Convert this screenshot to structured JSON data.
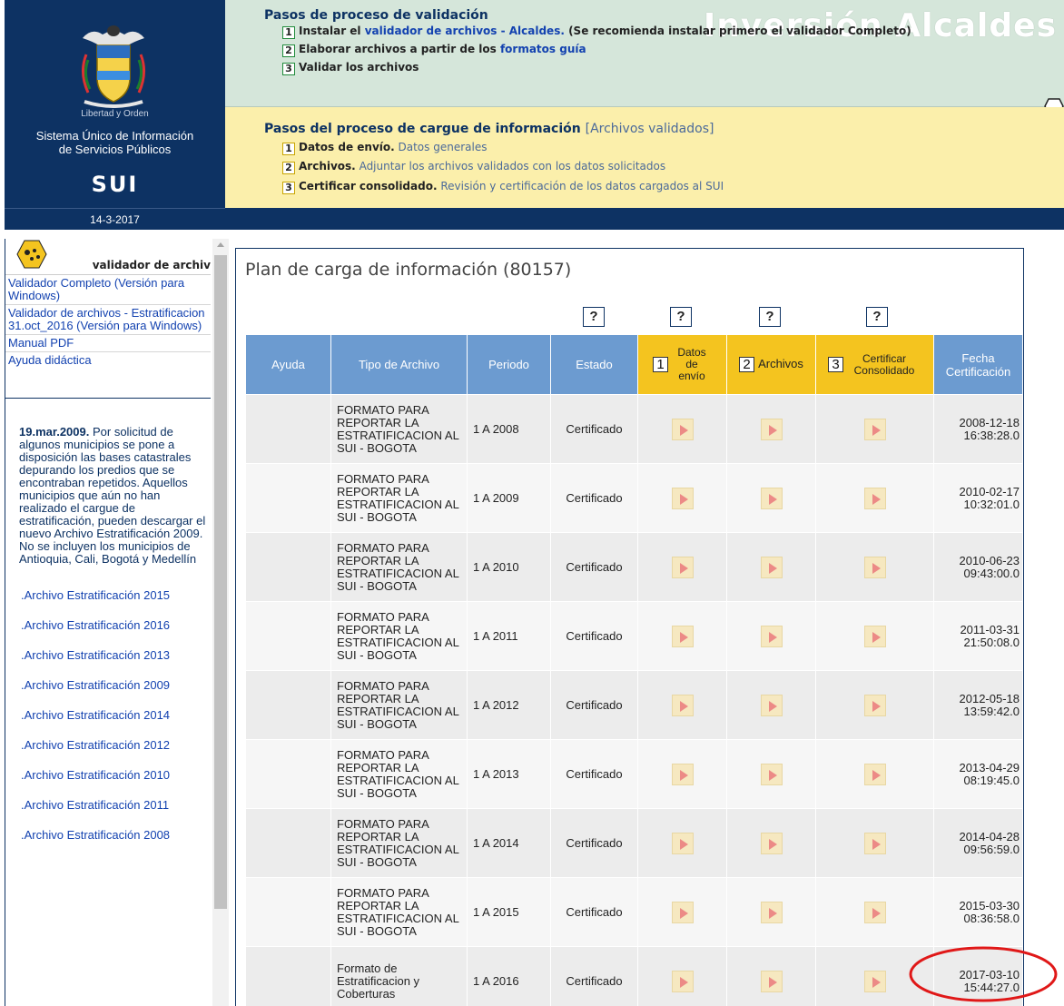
{
  "header": {
    "motto": "Libertad y Orden",
    "system_name_line1": "Sistema Único de Información",
    "system_name_line2": "de Servicios Públicos",
    "acronym": "SUI",
    "date": "14-3-2017",
    "brand": "Inversión Alcaldes",
    "validation": {
      "title": "Pasos de proceso de validación",
      "steps": [
        {
          "num": "1",
          "text": "Instalar el ",
          "link": "validador de archivos - Alcaldes.",
          "note": " (Se recomienda instalar primero el validador Completo)"
        },
        {
          "num": "2",
          "text": "Elaborar archivos a partir de los ",
          "link": "formatos guía",
          "note": ""
        },
        {
          "num": "3",
          "text": "Validar los archivos",
          "link": "",
          "note": ""
        }
      ]
    },
    "cargue": {
      "title": "Pasos del proceso de cargue de información",
      "title_note": "[Archivos validados]",
      "steps": [
        {
          "num": "1",
          "label": "Datos de envío.",
          "desc": " Datos generales"
        },
        {
          "num": "2",
          "label": "Archivos.",
          "desc": " Adjuntar los archivos validados con los datos solicitados"
        },
        {
          "num": "3",
          "label": "Certificar consolidado.",
          "desc": " Revisión y certificación de los datos cargados al SUI"
        }
      ]
    }
  },
  "sidebar": {
    "validator_label": "validador de archiv",
    "links": [
      "Validador Completo (Versión para Windows)",
      "Validador de archivos - Estratificacion 31.oct_2016 (Versión para Windows)",
      "Manual PDF",
      "Ayuda didáctica"
    ],
    "news_date": "19.mar.2009.",
    "news_text": " Por solicitud de algunos municipios se pone a disposición las bases catastrales depurando los predios que se encontraban repetidos. Aquellos municipios que aún no han realizado el cargue de estratificación, pueden descargar el nuevo Archivo Estratificación 2009. No se incluyen los municipios de Antioquia, Cali, Bogotá y Medellín",
    "archives": [
      ".Archivo Estratificación 2015",
      ".Archivo Estratificación 2016",
      ".Archivo Estratificación 2013",
      ".Archivo Estratificación 2009",
      ".Archivo Estratificación 2014",
      ".Archivo Estratificación 2012",
      ".Archivo Estratificación 2010",
      ".Archivo Estratificación 2011",
      ".Archivo Estratificación 2008"
    ]
  },
  "main": {
    "title": "Plan de carga de información (80157)",
    "help_label": "?",
    "columns": {
      "ayuda": "Ayuda",
      "tipo": "Tipo de Archivo",
      "periodo": "Periodo",
      "estado": "Estado",
      "datos_num": "1",
      "datos": "Datos de envío",
      "archivos_num": "2",
      "archivos": "Archivos",
      "certificar_num": "3",
      "certificar": "Certificar Consolidado",
      "fecha": "Fecha Certificación"
    },
    "rows": [
      {
        "tipo": "FORMATO PARA REPORTAR LA ESTRATIFICACION AL SUI - BOGOTA",
        "periodo": "1 A 2008",
        "estado": "Certificado",
        "fecha": "2008-12-18 16:38:28.0"
      },
      {
        "tipo": "FORMATO PARA REPORTAR LA ESTRATIFICACION AL SUI - BOGOTA",
        "periodo": "1 A 2009",
        "estado": "Certificado",
        "fecha": "2010-02-17 10:32:01.0"
      },
      {
        "tipo": "FORMATO PARA REPORTAR LA ESTRATIFICACION AL SUI - BOGOTA",
        "periodo": "1 A 2010",
        "estado": "Certificado",
        "fecha": "2010-06-23 09:43:00.0"
      },
      {
        "tipo": "FORMATO PARA REPORTAR LA ESTRATIFICACION AL SUI - BOGOTA",
        "periodo": "1 A 2011",
        "estado": "Certificado",
        "fecha": "2011-03-31 21:50:08.0"
      },
      {
        "tipo": "FORMATO PARA REPORTAR LA ESTRATIFICACION AL SUI - BOGOTA",
        "periodo": "1 A 2012",
        "estado": "Certificado",
        "fecha": "2012-05-18 13:59:42.0"
      },
      {
        "tipo": "FORMATO PARA REPORTAR LA ESTRATIFICACION AL SUI - BOGOTA",
        "periodo": "1 A 2013",
        "estado": "Certificado",
        "fecha": "2013-04-29 08:19:45.0"
      },
      {
        "tipo": "FORMATO PARA REPORTAR LA ESTRATIFICACION AL SUI - BOGOTA",
        "periodo": "1 A 2014",
        "estado": "Certificado",
        "fecha": "2014-04-28 09:56:59.0"
      },
      {
        "tipo": "FORMATO PARA REPORTAR LA ESTRATIFICACION AL SUI - BOGOTA",
        "periodo": "1 A 2015",
        "estado": "Certificado",
        "fecha": "2015-03-30 08:36:58.0"
      },
      {
        "tipo": "Formato de Estratificacion y Coberturas",
        "periodo": "1 A 2016",
        "estado": "Certificado",
        "fecha": "2017-03-10 15:44:27.0"
      }
    ]
  },
  "colors": {
    "navy": "#0d3263",
    "validation_bg": "#d5e6da",
    "cargue_bg": "#fbefab",
    "table_header": "#6c9bd0",
    "step_header": "#f4c41f",
    "annotation": "#e01818"
  },
  "icons": {
    "coat_of_arms": "coat-of-arms-icon",
    "validator": "validator-icon",
    "play": "play-icon",
    "collapse": "hexagon-toggle-icon"
  }
}
